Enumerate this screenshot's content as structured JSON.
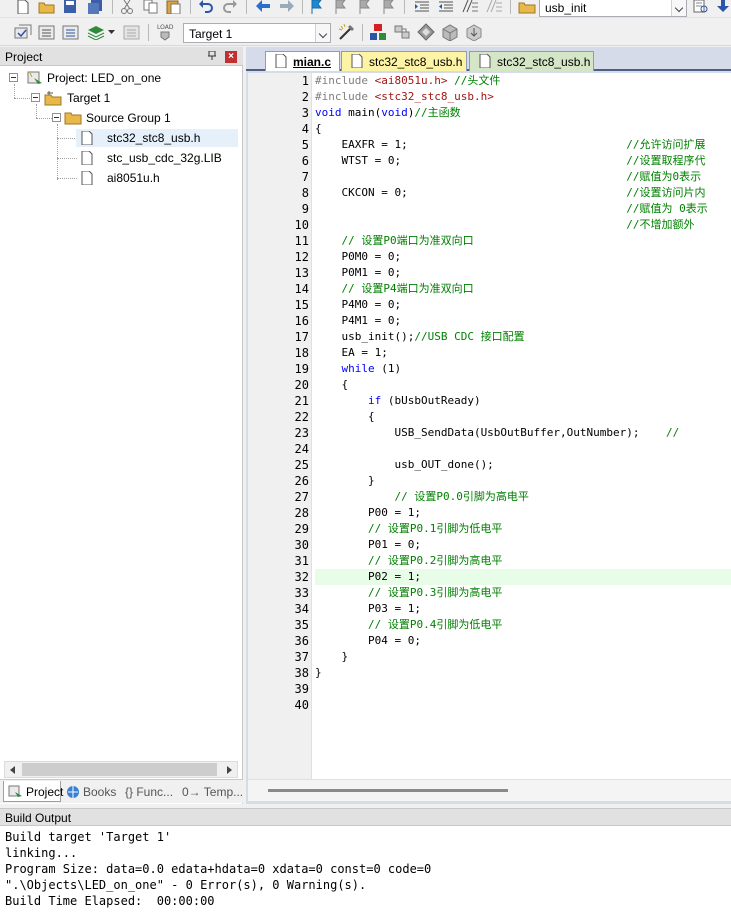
{
  "toolbar": {
    "target_select": "Target 1",
    "function_select": "usb_init"
  },
  "project_panel": {
    "title": "Project",
    "tree": {
      "project": "Project: LED_on_one",
      "target": "Target 1",
      "group": "Source Group 1",
      "files": [
        "stc32_stc8_usb.h",
        "stc_usb_cdc_32g.LIB",
        "ai8051u.h"
      ]
    },
    "tabs": [
      "Project",
      "Books",
      "{} Func...",
      "0→ Temp..."
    ]
  },
  "editor": {
    "tabs": [
      "mian.c",
      "stc32_stc8_usb.h",
      "stc32_stc8_usb.h"
    ],
    "highlight_line": 32,
    "lines": [
      [
        {
          "t": "#include ",
          "c": "pp"
        },
        {
          "t": "<ai8051u.h>",
          "c": "str"
        },
        {
          "t": " //头文件",
          "c": "cm"
        }
      ],
      [
        {
          "t": "#include ",
          "c": "pp"
        },
        {
          "t": "<stc32_stc8_usb.h>",
          "c": "str"
        }
      ],
      [
        {
          "t": "void",
          "c": "kw"
        },
        {
          "t": " main("
        },
        {
          "t": "void",
          "c": "kw"
        },
        {
          "t": ")"
        },
        {
          "t": "//主函数",
          "c": "cm"
        }
      ],
      [
        {
          "t": "{"
        }
      ],
      [
        {
          "t": "    EAXFR = 1;                                 "
        },
        {
          "t": "//允许访问扩展",
          "c": "cm"
        }
      ],
      [
        {
          "t": "    WTST = 0;                                  "
        },
        {
          "t": "//设置取程序代",
          "c": "cm"
        }
      ],
      [
        {
          "t": "                                               "
        },
        {
          "t": "//赋值为0表示",
          "c": "cm"
        }
      ],
      [
        {
          "t": "    CKCON = 0;                                 "
        },
        {
          "t": "//设置访问片内",
          "c": "cm"
        }
      ],
      [
        {
          "t": "                                               "
        },
        {
          "t": "//赋值为 0表示",
          "c": "cm"
        }
      ],
      [
        {
          "t": "                                               "
        },
        {
          "t": "//不增加额外",
          "c": "cm"
        }
      ],
      [
        {
          "t": "    "
        },
        {
          "t": "// 设置P0端口为准双向口",
          "c": "cm"
        }
      ],
      [
        {
          "t": "    P0M0 = 0;"
        }
      ],
      [
        {
          "t": "    P0M1 = 0;"
        }
      ],
      [
        {
          "t": "    "
        },
        {
          "t": "// 设置P4端口为准双向口",
          "c": "cm"
        }
      ],
      [
        {
          "t": "    P4M0 = 0;"
        }
      ],
      [
        {
          "t": "    P4M1 = 0;"
        }
      ],
      [
        {
          "t": "    usb_init();"
        },
        {
          "t": "//USB CDC 接口配置",
          "c": "cm"
        }
      ],
      [
        {
          "t": "    EA = 1;"
        }
      ],
      [
        {
          "t": "    "
        },
        {
          "t": "while",
          "c": "kw"
        },
        {
          "t": " (1)"
        }
      ],
      [
        {
          "t": "    {"
        }
      ],
      [
        {
          "t": "        "
        },
        {
          "t": "if",
          "c": "kw"
        },
        {
          "t": " (bUsbOutReady)"
        }
      ],
      [
        {
          "t": "        {"
        }
      ],
      [
        {
          "t": "            USB_SendData(UsbOutBuffer,OutNumber);    "
        },
        {
          "t": "//",
          "c": "cm"
        }
      ],
      [
        {
          "t": ""
        }
      ],
      [
        {
          "t": "            usb_OUT_done();"
        }
      ],
      [
        {
          "t": "        }"
        }
      ],
      [
        {
          "t": "            "
        },
        {
          "t": "// 设置P0.0引脚为高电平",
          "c": "cm"
        }
      ],
      [
        {
          "t": "        P00 = 1;"
        }
      ],
      [
        {
          "t": "        "
        },
        {
          "t": "// 设置P0.1引脚为低电平",
          "c": "cm"
        }
      ],
      [
        {
          "t": "        P01 = 0;"
        }
      ],
      [
        {
          "t": "        "
        },
        {
          "t": "// 设置P0.2引脚为高电平",
          "c": "cm"
        }
      ],
      [
        {
          "t": "        P02 = 1;"
        }
      ],
      [
        {
          "t": "        "
        },
        {
          "t": "// 设置P0.3引脚为高电平",
          "c": "cm"
        }
      ],
      [
        {
          "t": "        P03 = 1;"
        }
      ],
      [
        {
          "t": "        "
        },
        {
          "t": "// 设置P0.4引脚为低电平",
          "c": "cm"
        }
      ],
      [
        {
          "t": "        P04 = 0;"
        }
      ],
      [
        {
          "t": "    }"
        }
      ],
      [
        {
          "t": "}"
        }
      ],
      [
        {
          "t": ""
        }
      ],
      [
        {
          "t": ""
        }
      ]
    ]
  },
  "build_output": {
    "title": "Build Output",
    "lines": [
      "Build target 'Target 1'",
      "linking...",
      "Program Size: data=0.0 edata+hdata=0 xdata=0 const=0 code=0",
      "\".\\Objects\\LED_on_one\" - 0 Error(s), 0 Warning(s).",
      "Build Time Elapsed:  00:00:00"
    ]
  },
  "colors": {
    "comment": "#008000",
    "keyword": "#0000ff",
    "string": "#a31515",
    "preprocessor": "#7f7f7f",
    "current_line": "#e8fde8"
  }
}
